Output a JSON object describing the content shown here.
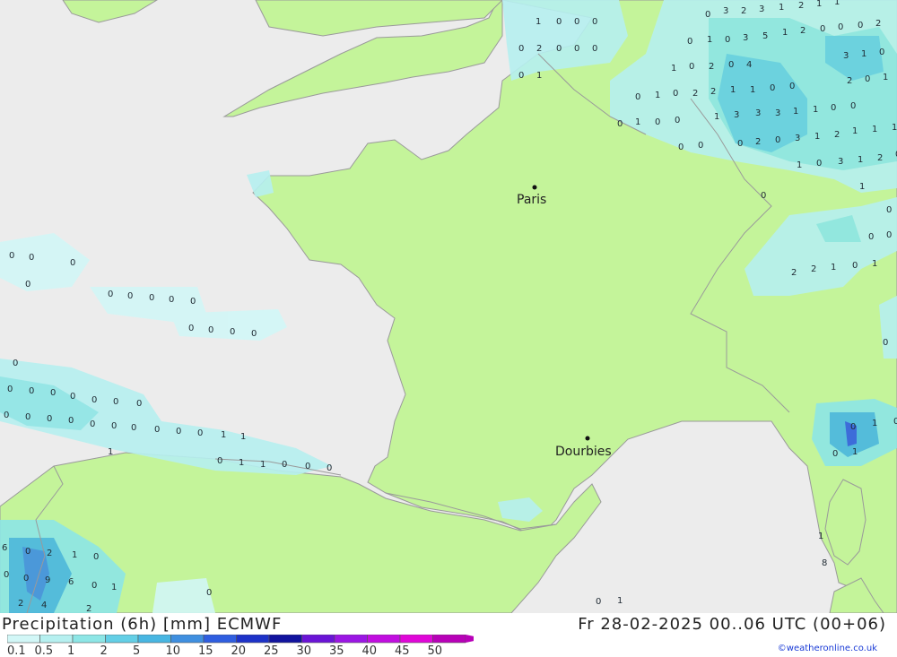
{
  "header": {
    "product_label": "Precipitation (6h) [mm] ECMWF",
    "datetime_label": "Fr 28-02-2025 00..06 UTC (00+06)"
  },
  "credit": "©weatheronline.co.uk",
  "colors": {
    "sea": "#ececec",
    "land": "#c4f49a",
    "border": "#9a9a9a"
  },
  "cities": [
    {
      "name": "Paris"
    },
    {
      "name": "Dourbies"
    }
  ],
  "legend": {
    "labels": [
      "0.1",
      "0.5",
      "1",
      "2",
      "5",
      "10",
      "15",
      "20",
      "25",
      "30",
      "35",
      "40",
      "45",
      "50"
    ],
    "colors": [
      "#d2f7f7",
      "#b6f0f0",
      "#8de6e6",
      "#63cfe6",
      "#48b6e2",
      "#3f8fe0",
      "#2f5ee0",
      "#1d32c8",
      "#11139e",
      "#6a14d6",
      "#9b16e4",
      "#c10ee0",
      "#e006d8",
      "#b800b8"
    ]
  },
  "precip_values": [
    "1",
    "0",
    "0",
    "0",
    "0",
    "2",
    "0",
    "0",
    "0",
    "0",
    "1",
    "0",
    "3",
    "2",
    "3",
    "1",
    "2",
    "1",
    "1",
    "0",
    "1",
    "0",
    "3",
    "5",
    "1",
    "2",
    "0",
    "0",
    "0",
    "2",
    "3",
    "1",
    "0",
    "1",
    "0",
    "2",
    "0",
    "4",
    "2",
    "0",
    "1",
    "0",
    "1",
    "0",
    "2",
    "2",
    "1",
    "1",
    "0",
    "0",
    "0",
    "1",
    "0",
    "0",
    "1",
    "3",
    "3",
    "3",
    "1",
    "1",
    "0",
    "0",
    "0",
    "2",
    "0",
    "3",
    "1",
    "2",
    "1",
    "1",
    "1",
    "0",
    "0",
    "1",
    "0",
    "3",
    "1",
    "2",
    "0",
    "1",
    "0",
    "0",
    "0",
    "0",
    "2",
    "2",
    "1",
    "0",
    "1",
    "0",
    "0",
    "0",
    "0",
    "0",
    "0",
    "0",
    "0",
    "0",
    "0",
    "0",
    "0",
    "0",
    "0",
    "0",
    "0",
    "0",
    "0",
    "0",
    "0",
    "0",
    "0",
    "0",
    "0",
    "0",
    "0",
    "0",
    "0",
    "0",
    "0",
    "0",
    "0",
    "1",
    "1",
    "1",
    "0",
    "1",
    "1",
    "0",
    "0",
    "0",
    "0",
    "1",
    "0",
    "0",
    "1",
    "1",
    "8",
    "6",
    "0",
    "2",
    "1",
    "0",
    "0",
    "0",
    "9",
    "6",
    "0",
    "1",
    "2",
    "4",
    "2",
    "0",
    "0",
    "1",
    "6",
    "0",
    "0",
    "0",
    "0"
  ]
}
